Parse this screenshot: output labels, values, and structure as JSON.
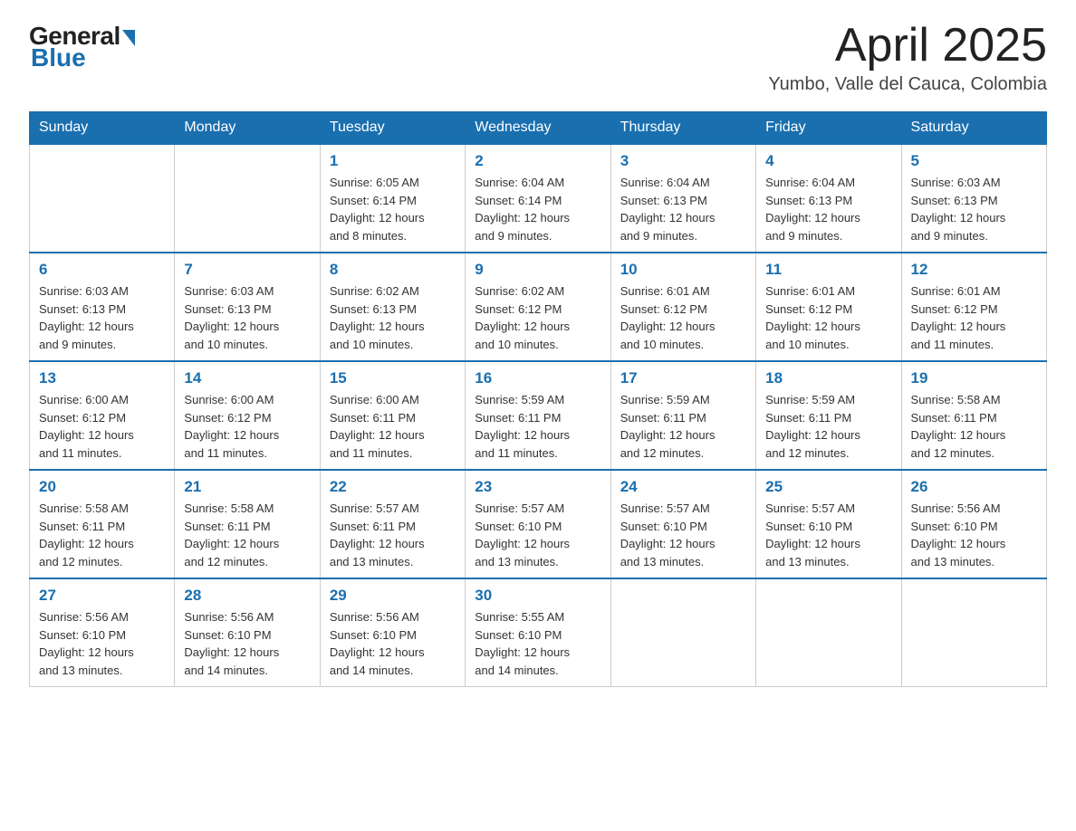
{
  "logo": {
    "general": "General",
    "blue": "Blue"
  },
  "header": {
    "month": "April 2025",
    "location": "Yumbo, Valle del Cauca, Colombia"
  },
  "weekdays": [
    "Sunday",
    "Monday",
    "Tuesday",
    "Wednesday",
    "Thursday",
    "Friday",
    "Saturday"
  ],
  "weeks": [
    [
      {
        "day": "",
        "info": ""
      },
      {
        "day": "",
        "info": ""
      },
      {
        "day": "1",
        "info": "Sunrise: 6:05 AM\nSunset: 6:14 PM\nDaylight: 12 hours\nand 8 minutes."
      },
      {
        "day": "2",
        "info": "Sunrise: 6:04 AM\nSunset: 6:14 PM\nDaylight: 12 hours\nand 9 minutes."
      },
      {
        "day": "3",
        "info": "Sunrise: 6:04 AM\nSunset: 6:13 PM\nDaylight: 12 hours\nand 9 minutes."
      },
      {
        "day": "4",
        "info": "Sunrise: 6:04 AM\nSunset: 6:13 PM\nDaylight: 12 hours\nand 9 minutes."
      },
      {
        "day": "5",
        "info": "Sunrise: 6:03 AM\nSunset: 6:13 PM\nDaylight: 12 hours\nand 9 minutes."
      }
    ],
    [
      {
        "day": "6",
        "info": "Sunrise: 6:03 AM\nSunset: 6:13 PM\nDaylight: 12 hours\nand 9 minutes."
      },
      {
        "day": "7",
        "info": "Sunrise: 6:03 AM\nSunset: 6:13 PM\nDaylight: 12 hours\nand 10 minutes."
      },
      {
        "day": "8",
        "info": "Sunrise: 6:02 AM\nSunset: 6:13 PM\nDaylight: 12 hours\nand 10 minutes."
      },
      {
        "day": "9",
        "info": "Sunrise: 6:02 AM\nSunset: 6:12 PM\nDaylight: 12 hours\nand 10 minutes."
      },
      {
        "day": "10",
        "info": "Sunrise: 6:01 AM\nSunset: 6:12 PM\nDaylight: 12 hours\nand 10 minutes."
      },
      {
        "day": "11",
        "info": "Sunrise: 6:01 AM\nSunset: 6:12 PM\nDaylight: 12 hours\nand 10 minutes."
      },
      {
        "day": "12",
        "info": "Sunrise: 6:01 AM\nSunset: 6:12 PM\nDaylight: 12 hours\nand 11 minutes."
      }
    ],
    [
      {
        "day": "13",
        "info": "Sunrise: 6:00 AM\nSunset: 6:12 PM\nDaylight: 12 hours\nand 11 minutes."
      },
      {
        "day": "14",
        "info": "Sunrise: 6:00 AM\nSunset: 6:12 PM\nDaylight: 12 hours\nand 11 minutes."
      },
      {
        "day": "15",
        "info": "Sunrise: 6:00 AM\nSunset: 6:11 PM\nDaylight: 12 hours\nand 11 minutes."
      },
      {
        "day": "16",
        "info": "Sunrise: 5:59 AM\nSunset: 6:11 PM\nDaylight: 12 hours\nand 11 minutes."
      },
      {
        "day": "17",
        "info": "Sunrise: 5:59 AM\nSunset: 6:11 PM\nDaylight: 12 hours\nand 12 minutes."
      },
      {
        "day": "18",
        "info": "Sunrise: 5:59 AM\nSunset: 6:11 PM\nDaylight: 12 hours\nand 12 minutes."
      },
      {
        "day": "19",
        "info": "Sunrise: 5:58 AM\nSunset: 6:11 PM\nDaylight: 12 hours\nand 12 minutes."
      }
    ],
    [
      {
        "day": "20",
        "info": "Sunrise: 5:58 AM\nSunset: 6:11 PM\nDaylight: 12 hours\nand 12 minutes."
      },
      {
        "day": "21",
        "info": "Sunrise: 5:58 AM\nSunset: 6:11 PM\nDaylight: 12 hours\nand 12 minutes."
      },
      {
        "day": "22",
        "info": "Sunrise: 5:57 AM\nSunset: 6:11 PM\nDaylight: 12 hours\nand 13 minutes."
      },
      {
        "day": "23",
        "info": "Sunrise: 5:57 AM\nSunset: 6:10 PM\nDaylight: 12 hours\nand 13 minutes."
      },
      {
        "day": "24",
        "info": "Sunrise: 5:57 AM\nSunset: 6:10 PM\nDaylight: 12 hours\nand 13 minutes."
      },
      {
        "day": "25",
        "info": "Sunrise: 5:57 AM\nSunset: 6:10 PM\nDaylight: 12 hours\nand 13 minutes."
      },
      {
        "day": "26",
        "info": "Sunrise: 5:56 AM\nSunset: 6:10 PM\nDaylight: 12 hours\nand 13 minutes."
      }
    ],
    [
      {
        "day": "27",
        "info": "Sunrise: 5:56 AM\nSunset: 6:10 PM\nDaylight: 12 hours\nand 13 minutes."
      },
      {
        "day": "28",
        "info": "Sunrise: 5:56 AM\nSunset: 6:10 PM\nDaylight: 12 hours\nand 14 minutes."
      },
      {
        "day": "29",
        "info": "Sunrise: 5:56 AM\nSunset: 6:10 PM\nDaylight: 12 hours\nand 14 minutes."
      },
      {
        "day": "30",
        "info": "Sunrise: 5:55 AM\nSunset: 6:10 PM\nDaylight: 12 hours\nand 14 minutes."
      },
      {
        "day": "",
        "info": ""
      },
      {
        "day": "",
        "info": ""
      },
      {
        "day": "",
        "info": ""
      }
    ]
  ]
}
